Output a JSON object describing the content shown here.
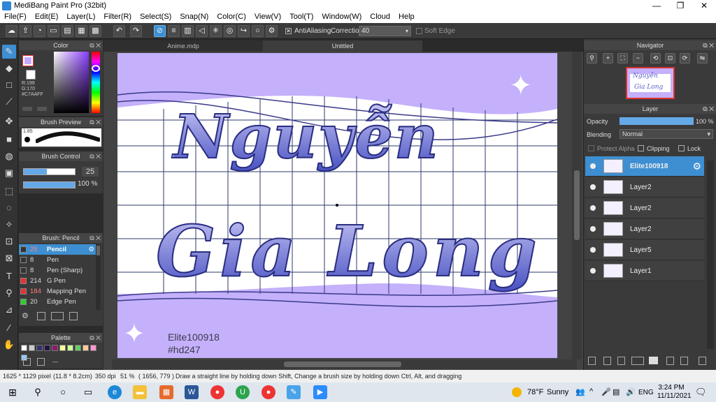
{
  "window": {
    "title": "MediBang Paint Pro (32bit)"
  },
  "menu": [
    "File(F)",
    "Edit(E)",
    "Layer(L)",
    "Filter(R)",
    "Select(S)",
    "Snap(N)",
    "Color(C)",
    "View(V)",
    "Tool(T)",
    "Window(W)",
    "Cloud",
    "Help"
  ],
  "toolbar": {
    "antialiasing": "AntiAliasing",
    "correction_label": "Correction",
    "correction_value": "40",
    "soft_edge": "Soft Edge"
  },
  "color_panel": {
    "title": "Color",
    "r": "R:199",
    "g": "G:170",
    "hex": "#C7AAFF",
    "main_color": "#c7aaff"
  },
  "brush_preview": {
    "title": "Brush Preview",
    "size": "1.85"
  },
  "brush_control": {
    "title": "Brush Control",
    "size": "25",
    "opacity": "100 %",
    "size_fraction": 0.25,
    "opacity_fraction": 1.0
  },
  "brush_list": {
    "title": "Brush: Pencil",
    "items": [
      {
        "size": "25",
        "name": "Pencil",
        "color": "#333333",
        "selected": true
      },
      {
        "size": "8",
        "name": "Pen",
        "color": "#333333",
        "selected": false
      },
      {
        "size": "8",
        "name": "Pen (Sharp)",
        "color": "#333333",
        "selected": false
      },
      {
        "size": "214",
        "name": "G Pen",
        "color": "#e33333",
        "selected": false
      },
      {
        "size": "184",
        "name": "Mapping Pen",
        "color": "#e33333",
        "selected": false
      },
      {
        "size": "20",
        "name": "Edge Pen",
        "color": "#33cc33",
        "selected": false
      }
    ]
  },
  "palette": {
    "title": "Palette",
    "colors": [
      "#ffffff",
      "#cccccc",
      "#333366",
      "#221144",
      "#8a1a6a",
      "#ffff99",
      "#ccff99",
      "#66cc66",
      "#ffcc99",
      "#ff99cc",
      "#99ccff",
      "#cc99ff",
      "#ffffff",
      "#999999",
      "#666666",
      "#000000"
    ],
    "more": "---"
  },
  "tabs": [
    {
      "label": "Anime.mdp",
      "active": false
    },
    {
      "label": "Untitled",
      "active": true
    }
  ],
  "artwork": {
    "line1": "Nguyễn",
    "line2": "Gia Long",
    "credit1": "Elite100918",
    "credit2": "#hd247"
  },
  "navigator": {
    "title": "Navigator"
  },
  "layer_panel": {
    "title": "Layer",
    "opacity_label": "Opacity",
    "opacity_value": "100 %",
    "blending_label": "Blending",
    "blending_value": "Normal",
    "protect_alpha": "Protect Alpha",
    "clipping": "Clipping",
    "lock": "Lock",
    "layers": [
      {
        "name": "Elite100918",
        "selected": true
      },
      {
        "name": "Layer2",
        "selected": false
      },
      {
        "name": "Layer2",
        "selected": false
      },
      {
        "name": "Layer2",
        "selected": false
      },
      {
        "name": "Layer5",
        "selected": false
      },
      {
        "name": "Layer1",
        "selected": false
      }
    ]
  },
  "status": {
    "size": "1625 * 1129 pixel",
    "cm": "(11.8 * 8.2cm)",
    "dpi": "350 dpi",
    "zoom": "51 %",
    "coords": "( 1656, 779 )",
    "hint": "Draw a straight line by holding down Shift, Change a brush size by holding down Ctrl, Alt, and dragging"
  },
  "taskbar": {
    "weather_temp": "78°F",
    "weather_desc": "Sunny",
    "lang": "ENG",
    "time": "3:24 PM",
    "date": "11/11/2021"
  }
}
